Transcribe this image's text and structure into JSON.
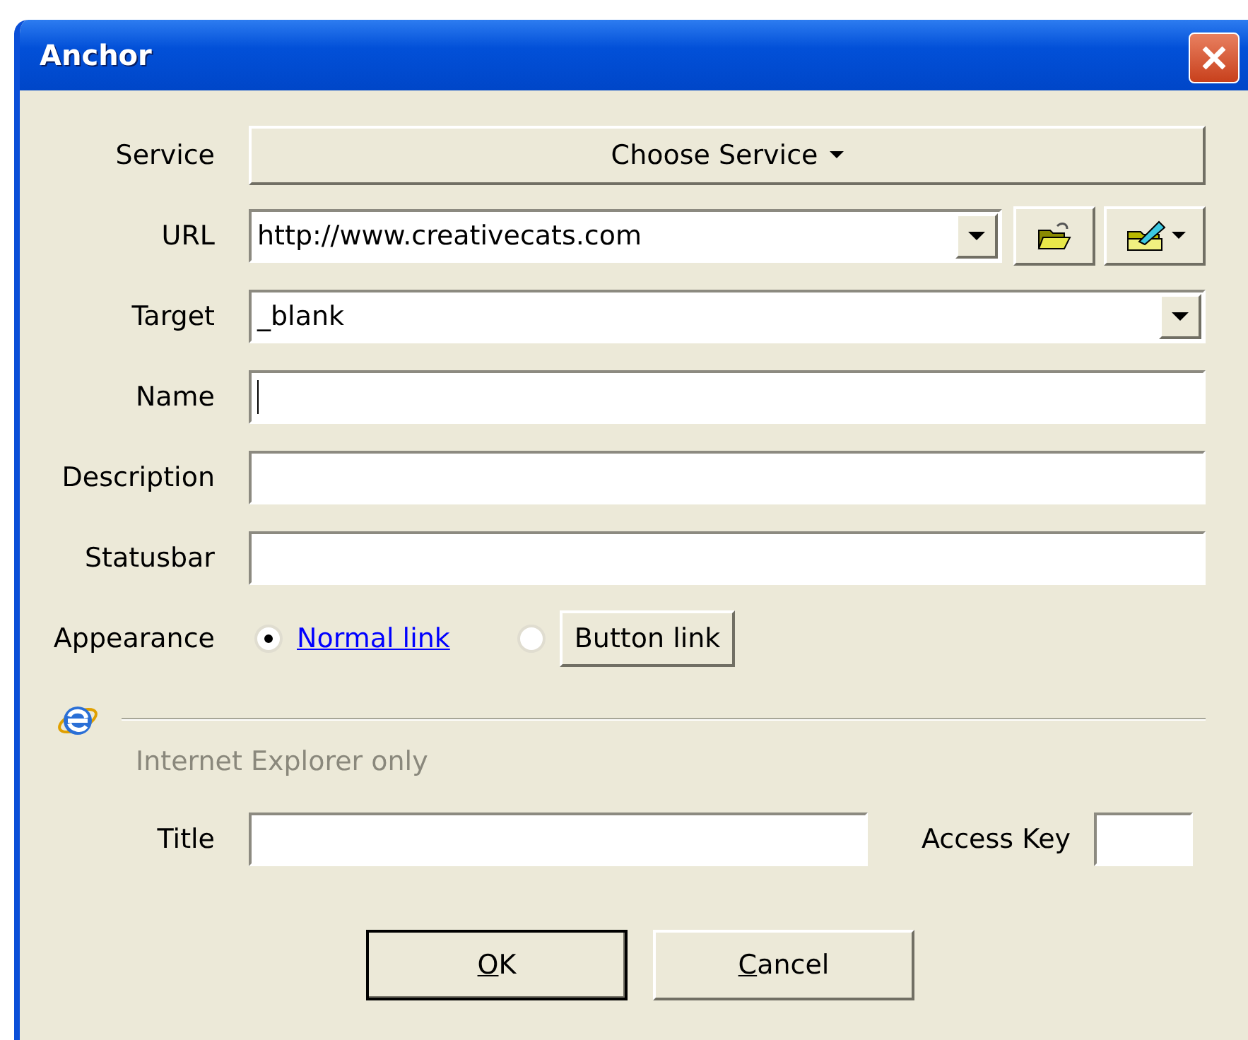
{
  "window": {
    "title": "Anchor"
  },
  "service": {
    "label": "Service",
    "button": "Choose Service"
  },
  "fields": [
    {
      "label": "URL",
      "kind": "combo",
      "value": "http://www.creativecats.com",
      "tools": true,
      "focused": false
    },
    {
      "label": "Target",
      "kind": "combo",
      "value": "_blank",
      "tools": false,
      "focused": false
    },
    {
      "label": "Name",
      "kind": "text",
      "focused": true
    },
    {
      "label": "Description",
      "kind": "text",
      "focused": false
    },
    {
      "label": "Statusbar",
      "kind": "text",
      "focused": false
    }
  ],
  "appearance": {
    "label": "Appearance",
    "options": [
      {
        "label": "Normal link",
        "kind": "link",
        "selected": true
      },
      {
        "label": "Button link",
        "kind": "button",
        "selected": false
      }
    ]
  },
  "ie_section": {
    "caption": "Internet Explorer only",
    "title_label": "Title",
    "access_key_label": "Access Key"
  },
  "buttons": [
    {
      "mnemonic": "O",
      "rest": "K",
      "default": true
    },
    {
      "mnemonic": "C",
      "rest": "ancel",
      "default": false
    }
  ]
}
